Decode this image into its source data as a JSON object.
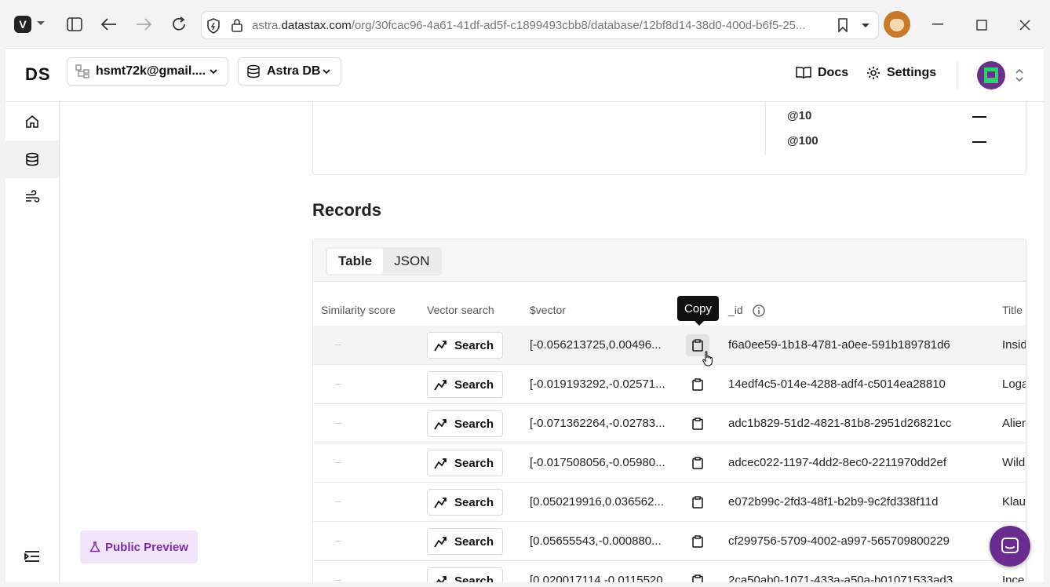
{
  "browser": {
    "url_scheme_part": "astra.",
    "url_host": "datastax.com",
    "url_path": "/org/30fcac96-4a61-41df-ad5f-c1899493cbb8/database/12bf8d14-38d0-400d-b6f5-25..."
  },
  "header": {
    "logo": "DS",
    "org_selector": "hsmt72k@gmail....",
    "product_selector": "Astra DB",
    "docs_label": "Docs",
    "settings_label": "Settings"
  },
  "metrics": {
    "rows": [
      {
        "label": "@10",
        "value": "—"
      },
      {
        "label": "@100",
        "value": "—"
      }
    ]
  },
  "records": {
    "title": "Records",
    "tabs": [
      {
        "label": "Table",
        "active": true
      },
      {
        "label": "JSON",
        "active": false
      }
    ],
    "columns": {
      "similarity": "Similarity score",
      "vector_search": "Vector search",
      "vector": "$vector",
      "id": "_id",
      "title": "Title"
    },
    "search_label": "Search",
    "tooltip": "Copy",
    "rows": [
      {
        "vector": "[-0.056213725,0.00496...",
        "id": "f6a0ee59-1b18-4781-a0ee-591b189781d6",
        "title": "Insid"
      },
      {
        "vector": "[-0.019193292,-0.02571...",
        "id": "14edf4c5-014e-4288-adf4-c5014ea28810",
        "title": "Loga"
      },
      {
        "vector": "[-0.071362264,-0.02783...",
        "id": "adc1b829-51d2-4821-81b8-2951d26821cc",
        "title": "Alien"
      },
      {
        "vector": "[-0.017508056,-0.05980...",
        "id": "adcec022-1197-4dd2-8ec0-2211970dd2ef",
        "title": "Wild"
      },
      {
        "vector": "[0.050219916,0.036562...",
        "id": "e072b99c-2fd3-48f1-b2b9-9c2fd338f11d",
        "title": "Klau"
      },
      {
        "vector": "[0.05655543,-0.000880...",
        "id": "cf299756-5709-4002-a997-565709800229",
        "title": ""
      },
      {
        "vector": "[0.020017114,-0.0115520...",
        "id": "2ca50ab0-1071-433a-a50a-b01071533ad3",
        "title": "Ince"
      }
    ]
  },
  "sidebar": {
    "preview_badge": "Public Preview"
  },
  "colors": {
    "accent": "#6a2c91",
    "badge_bg": "#f1e4fb",
    "badge_text": "#7a2fa8"
  }
}
